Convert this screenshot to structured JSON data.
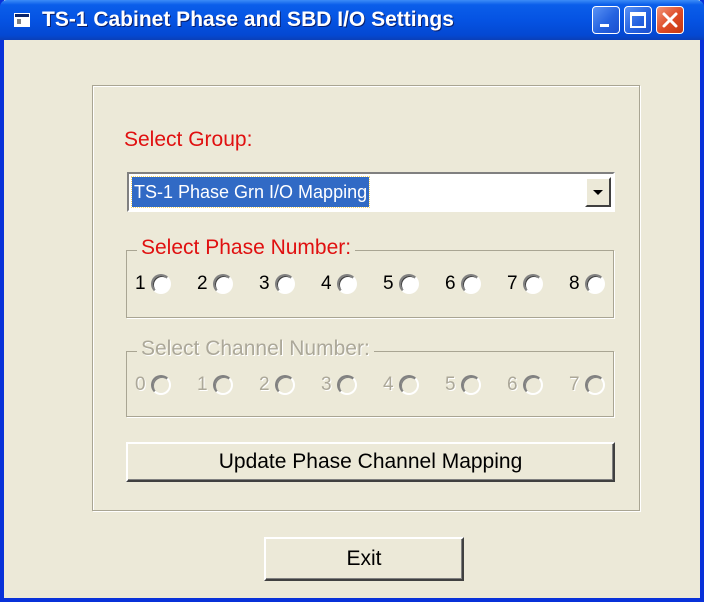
{
  "window": {
    "title": "TS-1 Cabinet Phase and SBD I/O Settings",
    "title_icon": "app-window-icon",
    "controls": [
      "minimize-icon",
      "maximize-icon",
      "close-icon"
    ]
  },
  "group_select": {
    "label": "Select Group:",
    "value": "TS-1 Phase Grn I/O Mapping"
  },
  "phase": {
    "legend": "Select Phase Number:",
    "options": [
      "1",
      "2",
      "3",
      "4",
      "5",
      "6",
      "7",
      "8"
    ]
  },
  "channel": {
    "legend": "Select Channel Number:",
    "options": [
      "0",
      "1",
      "2",
      "3",
      "4",
      "5",
      "6",
      "7"
    ],
    "enabled": false
  },
  "buttons": {
    "update": "Update Phase Channel Mapping",
    "exit": "Exit"
  },
  "colors": {
    "label_red": "#E01010",
    "title_blue": "#0553E3",
    "selection_blue": "#316AC5",
    "dialog_bg": "#ECE9D8"
  }
}
